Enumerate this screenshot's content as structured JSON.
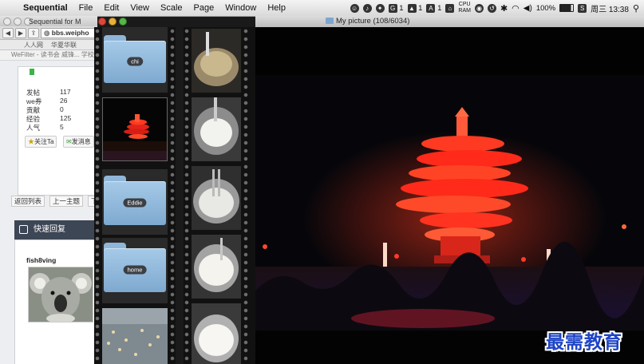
{
  "menubar": {
    "app_name": "Sequential",
    "menus": [
      "File",
      "Edit",
      "View",
      "Scale",
      "Page",
      "Window",
      "Help"
    ],
    "status": {
      "item_a": "1",
      "item_b": "1",
      "item_c": "1",
      "cpu_top": "CPU",
      "cpu_bottom": "RAM",
      "battery": "100%",
      "clock": "周三 13:38"
    }
  },
  "browser": {
    "window_title": "Sequential for M",
    "url": "bbs.weipho",
    "bookmarks": [
      "人人网",
      "华夏华联"
    ],
    "tab_title": "WeFilter - 读书会 威锋... 学校系统...",
    "profile": {
      "stats": [
        {
          "label": "发帖",
          "value": "117"
        },
        {
          "label": "we券",
          "value": "26"
        },
        {
          "label": "贡献",
          "value": "0"
        },
        {
          "label": "经验",
          "value": "125"
        },
        {
          "label": "人气",
          "value": "5"
        }
      ],
      "follow_button": "关注Ta",
      "message_button": "发消息"
    },
    "nav": [
      "返回列表",
      "上一主题",
      "下"
    ],
    "quick_reply": "快速回复",
    "username": "fish8ving"
  },
  "filmstrip": {
    "folders": [
      "chi",
      "Eddie",
      "home"
    ]
  },
  "viewer": {
    "title": "My picture (108/6034)"
  },
  "watermark": "最需教育",
  "colors": {
    "folder_blue": "#8fb6d8",
    "sculpture_red": "#ff2a1a",
    "watermark_blue": "#1e44c6",
    "close_light": "#e0463b",
    "minimize_light": "#e8b13a",
    "zoom_light": "#56b847"
  }
}
